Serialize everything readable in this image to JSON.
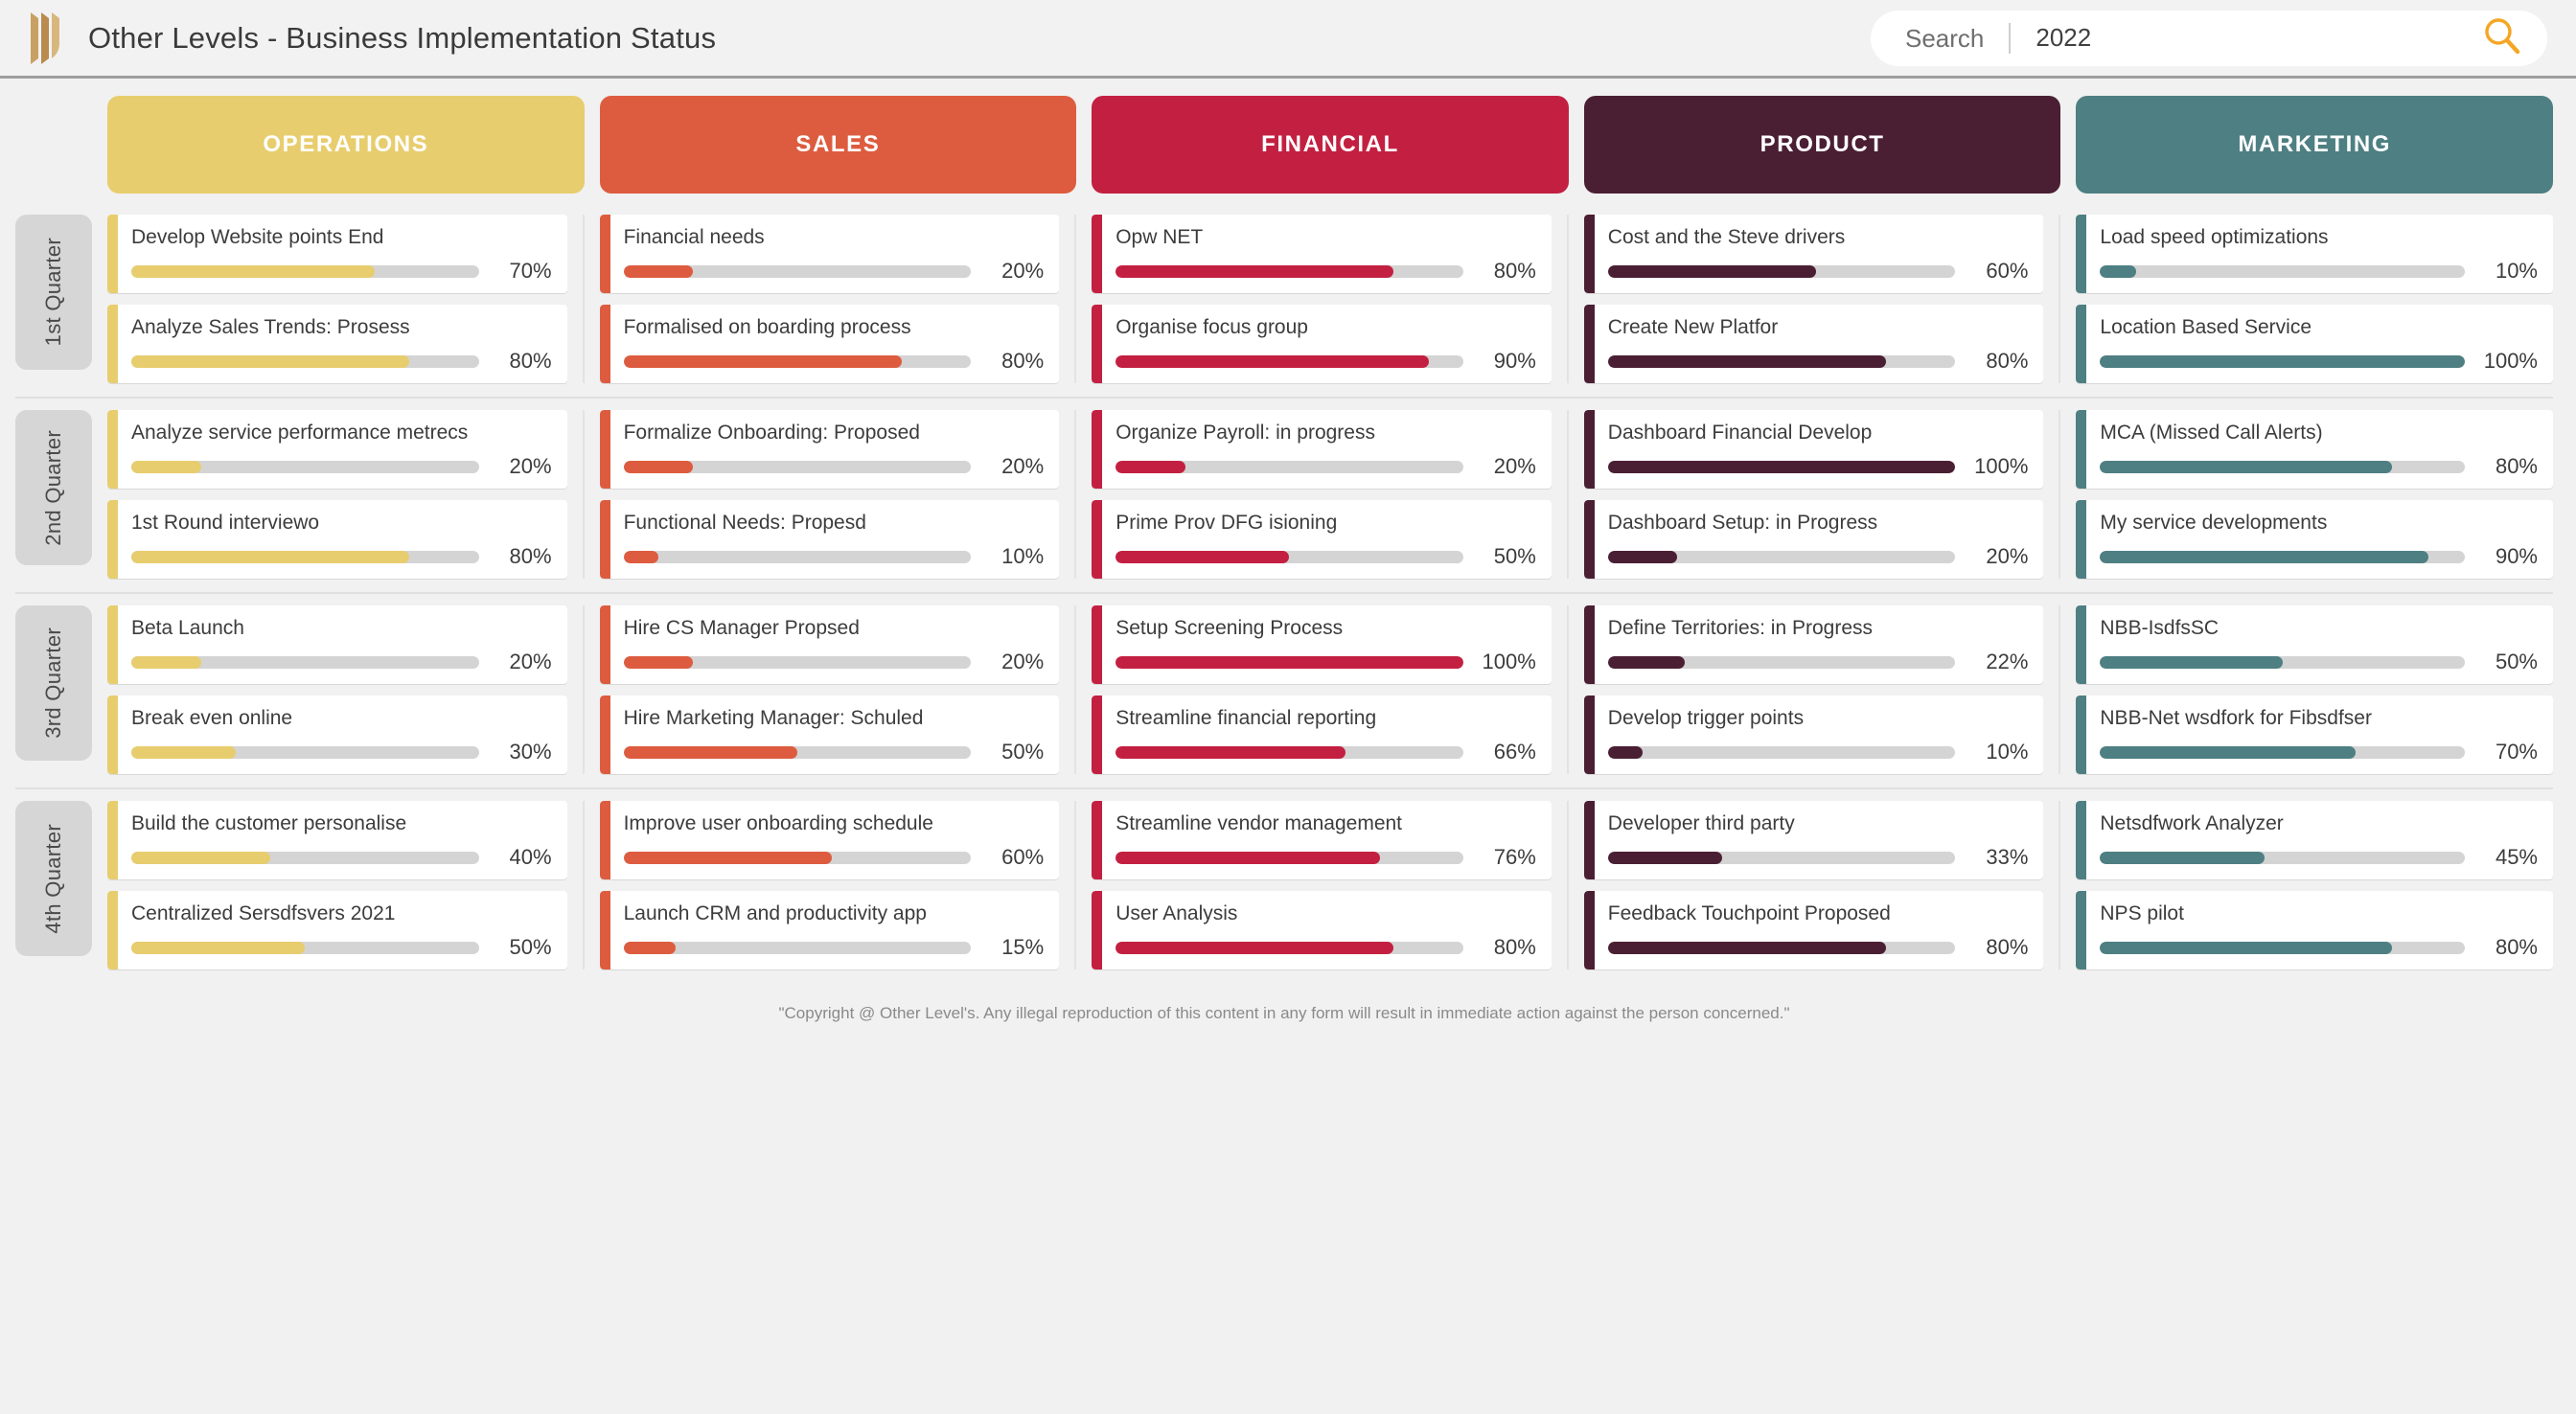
{
  "header": {
    "logo_icon": "pillars-logo-icon",
    "title": "Other Levels - Business Implementation Status",
    "search": {
      "label": "Search",
      "value": "2022",
      "placeholder": "2022",
      "icon": "search-icon",
      "icon_color": "#f5a623"
    }
  },
  "columns": [
    {
      "label": "OPERATIONS",
      "color": "#e8cd6e"
    },
    {
      "label": "SALES",
      "color": "#dd5c3f"
    },
    {
      "label": "FINANCIAL",
      "color": "#c32041"
    },
    {
      "label": "PRODUCT",
      "color": "#4b1f33"
    },
    {
      "label": "MARKETING",
      "color": "#4e7f82"
    }
  ],
  "quarters": [
    {
      "label": "1st Quarter"
    },
    {
      "label": "2nd Quarter"
    },
    {
      "label": "3rd Quarter"
    },
    {
      "label": "4th Quarter"
    }
  ],
  "cells": {
    "q1": {
      "operations": [
        {
          "title": "Develop Website points End",
          "percent": 70,
          "percent_label": "70%"
        },
        {
          "title": "Analyze Sales Trends: Prosess",
          "percent": 80,
          "percent_label": "80%"
        }
      ],
      "sales": [
        {
          "title": "Financial needs",
          "percent": 20,
          "percent_label": "20%"
        },
        {
          "title": "Formalised on boarding process",
          "percent": 80,
          "percent_label": "80%"
        }
      ],
      "financial": [
        {
          "title": "Opw NET",
          "percent": 80,
          "percent_label": "80%"
        },
        {
          "title": "Organise focus group",
          "percent": 90,
          "percent_label": "90%"
        }
      ],
      "product": [
        {
          "title": "Cost and the Steve drivers",
          "percent": 60,
          "percent_label": "60%"
        },
        {
          "title": "Create New Platfor",
          "percent": 80,
          "percent_label": "80%"
        }
      ],
      "marketing": [
        {
          "title": "Load speed optimizations",
          "percent": 10,
          "percent_label": "10%"
        },
        {
          "title": "Location Based Service",
          "percent": 100,
          "percent_label": "100%"
        }
      ]
    },
    "q2": {
      "operations": [
        {
          "title": "Analyze service performance metrecs",
          "percent": 20,
          "percent_label": "20%"
        },
        {
          "title": "1st Round interviewo",
          "percent": 80,
          "percent_label": "80%"
        }
      ],
      "sales": [
        {
          "title": "Formalize Onboarding: Proposed",
          "percent": 20,
          "percent_label": "20%"
        },
        {
          "title": "Functional Needs: Propesd",
          "percent": 10,
          "percent_label": "10%"
        }
      ],
      "financial": [
        {
          "title": "Organize Payroll: in progress",
          "percent": 20,
          "percent_label": "20%"
        },
        {
          "title": "Prime Prov DFG isioning",
          "percent": 50,
          "percent_label": "50%"
        }
      ],
      "product": [
        {
          "title": "Dashboard Financial Develop",
          "percent": 100,
          "percent_label": "100%"
        },
        {
          "title": "Dashboard Setup: in Progress",
          "percent": 20,
          "percent_label": "20%"
        }
      ],
      "marketing": [
        {
          "title": "MCA (Missed Call Alerts)",
          "percent": 80,
          "percent_label": "80%"
        },
        {
          "title": "My service developments",
          "percent": 90,
          "percent_label": "90%"
        }
      ]
    },
    "q3": {
      "operations": [
        {
          "title": "Beta Launch",
          "percent": 20,
          "percent_label": "20%"
        },
        {
          "title": "Break even online",
          "percent": 30,
          "percent_label": "30%"
        }
      ],
      "sales": [
        {
          "title": "Hire CS Manager Propsed",
          "percent": 20,
          "percent_label": "20%"
        },
        {
          "title": "Hire Marketing Manager: Schuled",
          "percent": 50,
          "percent_label": "50%"
        }
      ],
      "financial": [
        {
          "title": "Setup Screening Process",
          "percent": 100,
          "percent_label": "100%"
        },
        {
          "title": "Streamline financial reporting",
          "percent": 66,
          "percent_label": "66%"
        }
      ],
      "product": [
        {
          "title": "Define Territories: in Progress",
          "percent": 22,
          "percent_label": "22%"
        },
        {
          "title": "Develop trigger points",
          "percent": 10,
          "percent_label": "10%"
        }
      ],
      "marketing": [
        {
          "title": "NBB-IsdfsSC",
          "percent": 50,
          "percent_label": "50%"
        },
        {
          "title": "NBB-Net wsdfork for Fibsdfser",
          "percent": 70,
          "percent_label": "70%"
        }
      ]
    },
    "q4": {
      "operations": [
        {
          "title": "Build the customer personalise",
          "percent": 40,
          "percent_label": "40%"
        },
        {
          "title": "Centralized Sersdfsvers 2021",
          "percent": 50,
          "percent_label": "50%"
        }
      ],
      "sales": [
        {
          "title": "Improve user onboarding schedule",
          "percent": 60,
          "percent_label": "60%"
        },
        {
          "title": "Launch CRM and productivity app",
          "percent": 15,
          "percent_label": "15%"
        }
      ],
      "financial": [
        {
          "title": "Streamline vendor management",
          "percent": 76,
          "percent_label": "76%"
        },
        {
          "title": "User Analysis",
          "percent": 80,
          "percent_label": "80%"
        }
      ],
      "product": [
        {
          "title": "Developer third party",
          "percent": 33,
          "percent_label": "33%"
        },
        {
          "title": "Feedback Touchpoint Proposed",
          "percent": 80,
          "percent_label": "80%"
        }
      ],
      "marketing": [
        {
          "title": "Netsdfwork Analyzer",
          "percent": 45,
          "percent_label": "45%"
        },
        {
          "title": "NPS pilot",
          "percent": 80,
          "percent_label": "80%"
        }
      ]
    }
  },
  "footer": {
    "copyright": "\"Copyright @ Other Level's. Any illegal reproduction of this content in any form will result in immediate action against the person concerned.\""
  }
}
